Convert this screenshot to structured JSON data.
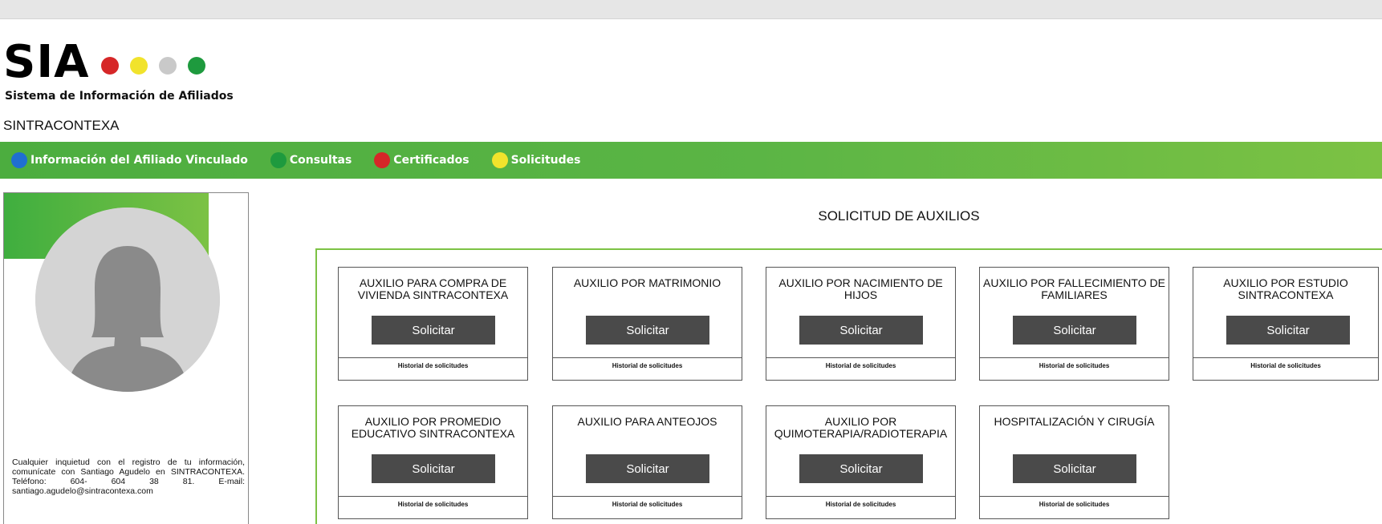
{
  "brand": {
    "name": "SIA",
    "tagline": "Sistema de Información de Afiliados",
    "organization": "SINTRACONTEXA",
    "dot_colors": [
      "#d62728",
      "#f1e32c",
      "#c9c9c9",
      "#1e9a3e"
    ]
  },
  "nav": {
    "items": [
      {
        "label": "Información del Afiliado Vinculado",
        "color": "#1f6fd1"
      },
      {
        "label": "Consultas",
        "color": "#1e9a3e"
      },
      {
        "label": "Certificados",
        "color": "#d62728"
      },
      {
        "label": "Solicitudes",
        "color": "#f1e32c"
      }
    ]
  },
  "profile": {
    "note": "Cualquier inquietud con el registro de tu información, comunícate con Santiago Agudelo en SINTRACONTEXA. Teléfono: 604- 604 38 81. E-mail: santiago.agudelo@sintracontexa.com"
  },
  "main": {
    "title": "SOLICITUD DE AUXILIOS",
    "cards": [
      {
        "title": "AUXILIO PARA COMPRA DE VIVIENDA SINTRACONTEXA",
        "button": "Solicitar",
        "link": "Historial de solicitudes"
      },
      {
        "title": "AUXILIO POR MATRIMONIO",
        "button": "Solicitar",
        "link": "Historial de solicitudes"
      },
      {
        "title": "AUXILIO POR NACIMIENTO DE HIJOS",
        "button": "Solicitar",
        "link": "Historial de solicitudes"
      },
      {
        "title": "AUXILIO POR FALLECIMIENTO DE FAMILIARES",
        "button": "Solicitar",
        "link": "Historial de solicitudes"
      },
      {
        "title": "AUXILIO POR ESTUDIO SINTRACONTEXA",
        "button": "Solicitar",
        "link": "Historial de solicitudes"
      },
      {
        "title": "AUXILIO POR PROMEDIO EDUCATIVO SINTRACONTEXA",
        "button": "Solicitar",
        "link": "Historial de solicitudes"
      },
      {
        "title": "AUXILIO PARA ANTEOJOS",
        "button": "Solicitar",
        "link": "Historial de solicitudes"
      },
      {
        "title": "AUXILIO POR QUIMOTERAPIA/RADIOTERAPIA",
        "button": "Solicitar",
        "link": "Historial de solicitudes"
      },
      {
        "title": "HOSPITALIZACIÓN Y CIRUGÍA",
        "button": "Solicitar",
        "link": "Historial de solicitudes"
      }
    ]
  }
}
